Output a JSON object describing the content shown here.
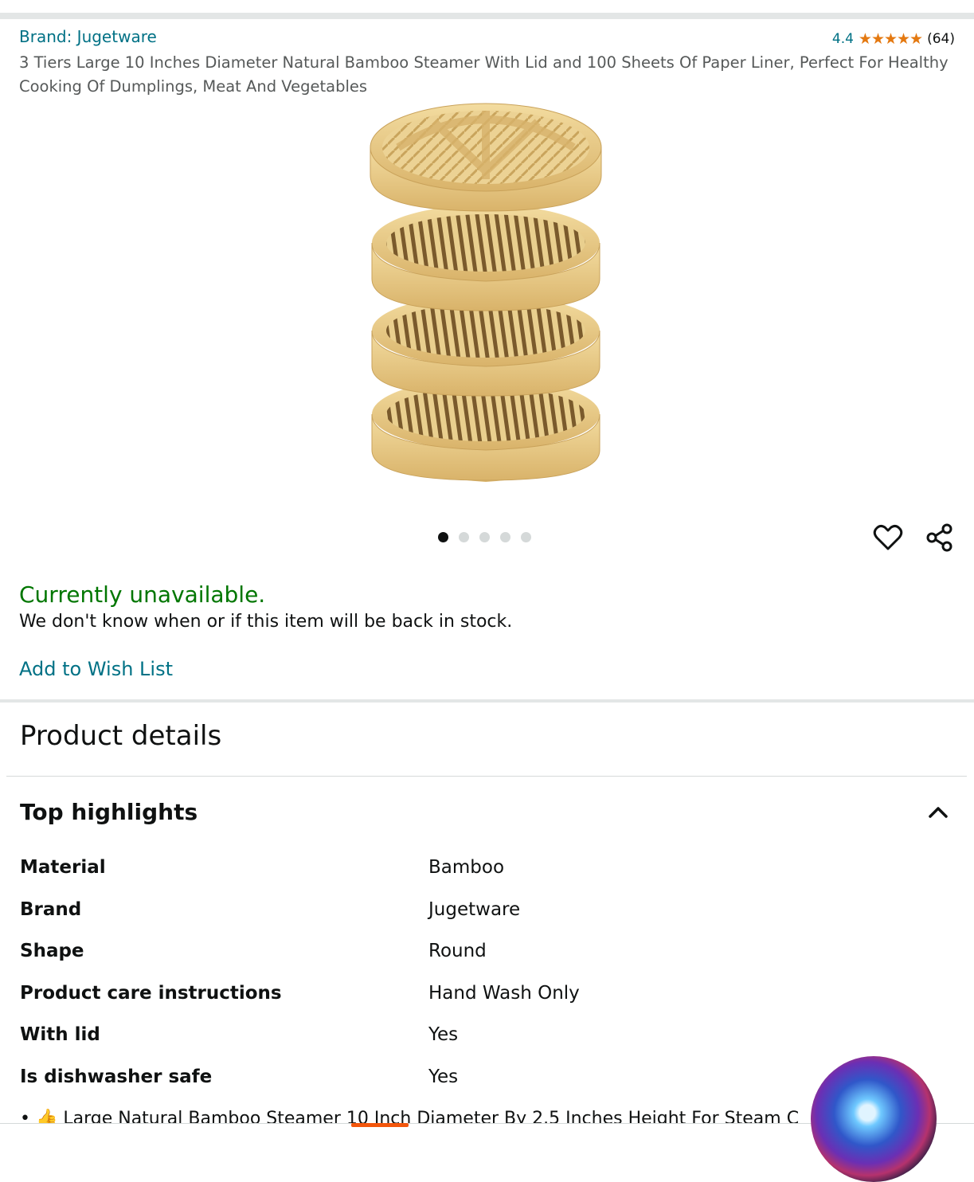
{
  "product": {
    "brand": "Brand: Jugetware",
    "rating": "4.4",
    "stars": "★★★★★",
    "review_count": "(64)",
    "title": "3 Tiers Large 10 Inches Diameter Natural Bamboo Steamer With Lid and 100 Sheets Of Paper Liner, Perfect For Healthy Cooking Of Dumplings, Meat And Vegetables"
  },
  "gallery": {
    "image_count": 5,
    "active_index": 0
  },
  "availability": {
    "status": "Currently unavailable.",
    "message": "We don't know when or if this item will be back in stock.",
    "wish_list_label": "Add to Wish List"
  },
  "details": {
    "title": "Product details",
    "highlights_title": "Top highlights",
    "specs": [
      {
        "key": "Material",
        "value": "Bamboo"
      },
      {
        "key": "Brand",
        "value": "Jugetware"
      },
      {
        "key": "Shape",
        "value": "Round"
      },
      {
        "key": "Product care instructions",
        "value": "Hand Wash Only"
      },
      {
        "key": "With lid",
        "value": "Yes"
      },
      {
        "key": "Is dishwasher safe",
        "value": "Yes"
      }
    ],
    "bullet_partial": "• 👍 Large Natural Bamboo Steamer 10 Inch Diameter By 2.5 Inches Height For Steam C"
  },
  "colors": {
    "link": "#007185",
    "available": "#007600",
    "star": "#e47911",
    "accent": "#f3560c"
  },
  "icons": [
    "heart-icon",
    "share-icon",
    "chevron-up-icon",
    "siri-icon"
  ]
}
